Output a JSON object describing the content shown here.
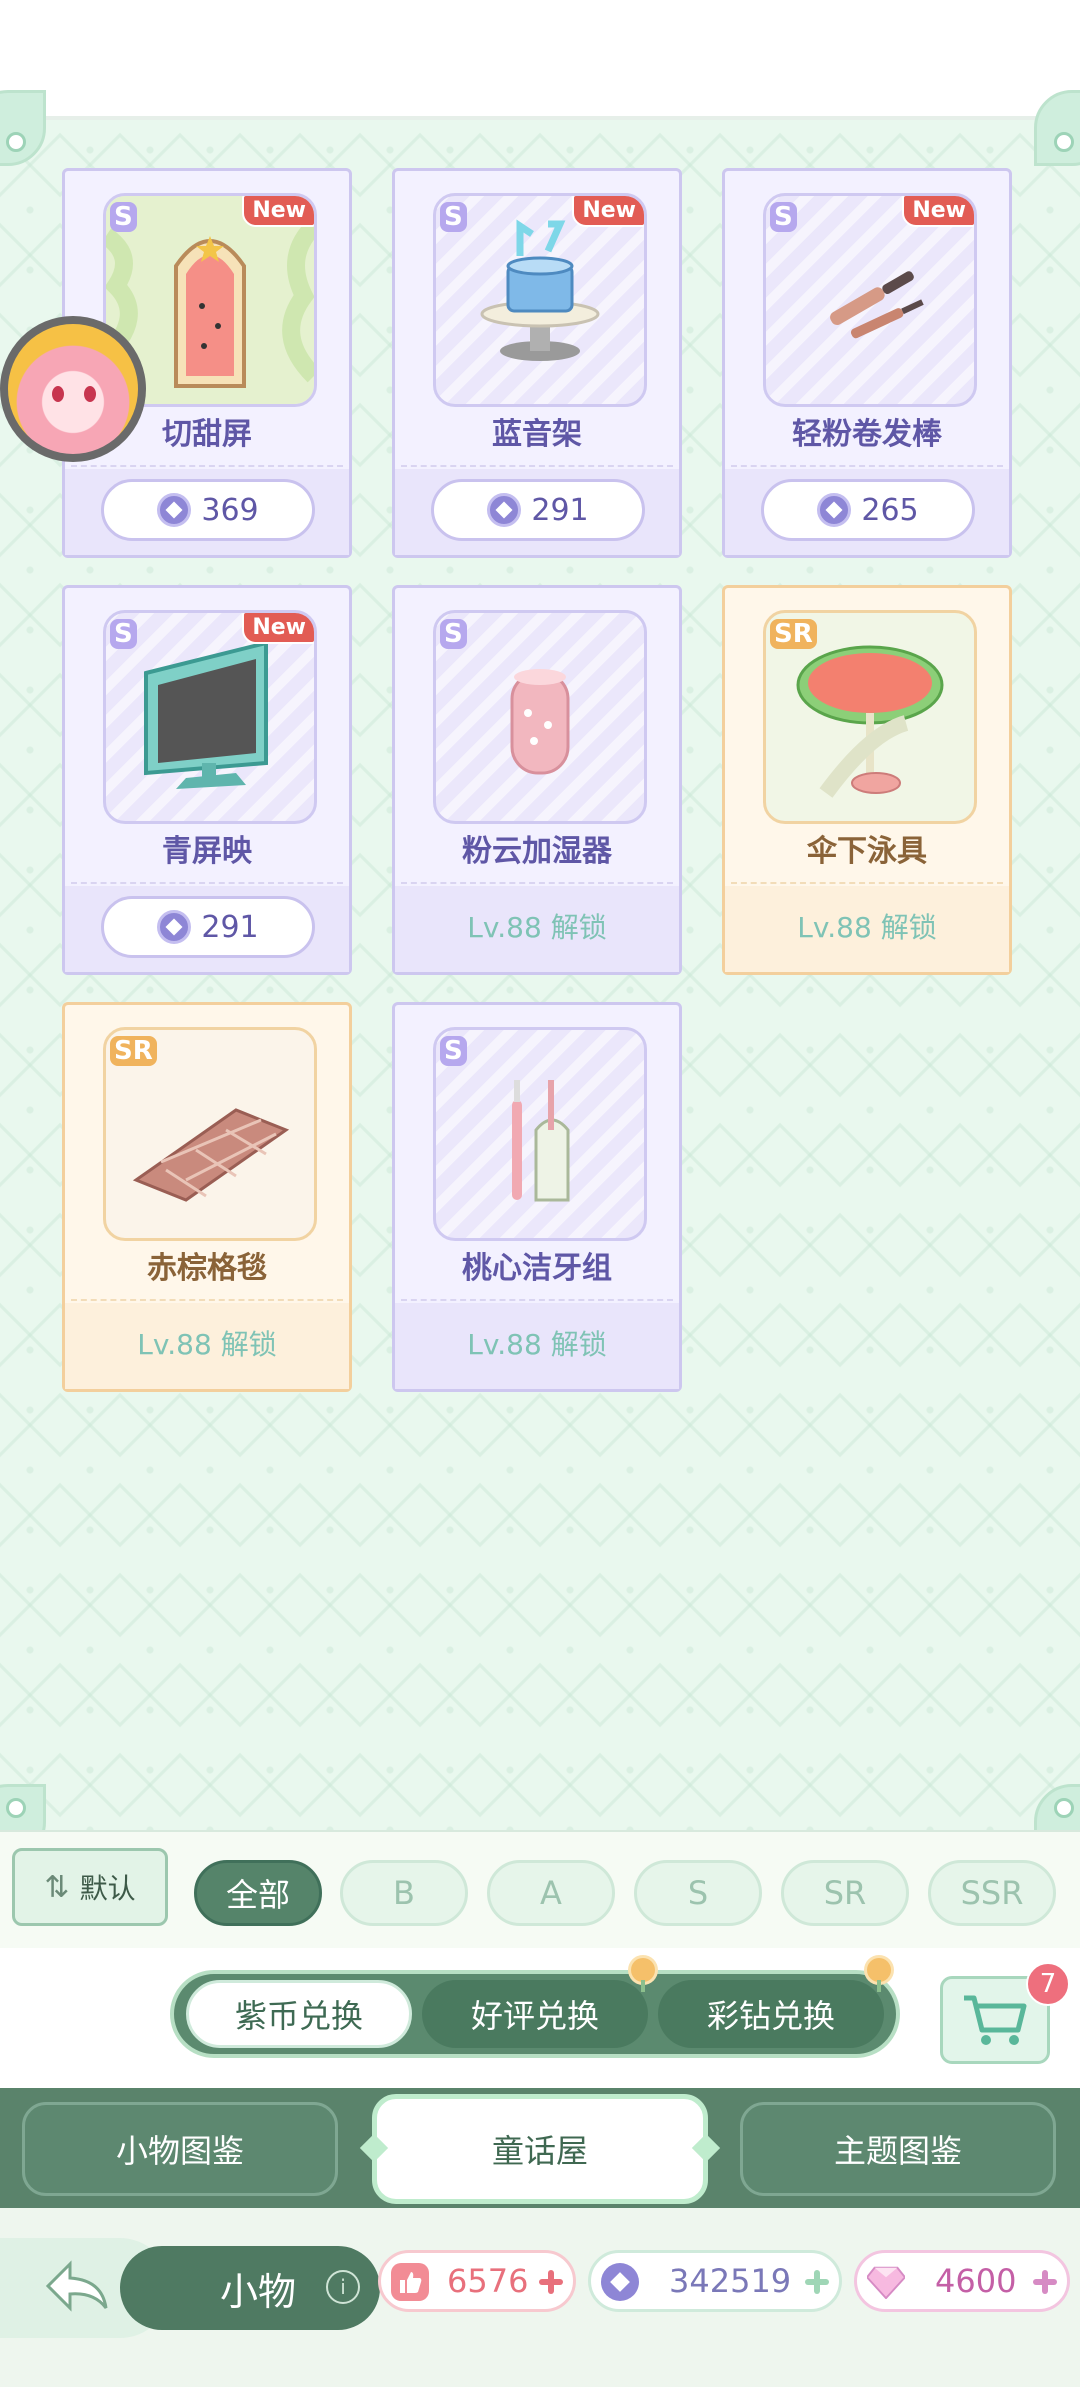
{
  "items": [
    {
      "rarity": "S",
      "is_new": true,
      "new_label": "New",
      "name": "切甜屏",
      "price": "369",
      "unlock": ""
    },
    {
      "rarity": "S",
      "is_new": true,
      "new_label": "New",
      "name": "蓝音架",
      "price": "291",
      "unlock": ""
    },
    {
      "rarity": "S",
      "is_new": true,
      "new_label": "New",
      "name": "轻粉卷发棒",
      "price": "265",
      "unlock": ""
    },
    {
      "rarity": "S",
      "is_new": true,
      "new_label": "New",
      "name": "青屏映",
      "price": "291",
      "unlock": ""
    },
    {
      "rarity": "S",
      "is_new": false,
      "new_label": "",
      "name": "粉云加湿器",
      "price": "",
      "unlock": "Lv.88 解锁"
    },
    {
      "rarity": "SR",
      "is_new": false,
      "new_label": "",
      "name": "伞下泳具",
      "price": "",
      "unlock": "Lv.88 解锁"
    },
    {
      "rarity": "SR",
      "is_new": false,
      "new_label": "",
      "name": "赤棕格毯",
      "price": "",
      "unlock": "Lv.88 解锁"
    },
    {
      "rarity": "S",
      "is_new": false,
      "new_label": "",
      "name": "桃心洁牙组",
      "price": "",
      "unlock": "Lv.88 解锁"
    }
  ],
  "filter": {
    "sort_label": "默认",
    "rarity_tabs": [
      {
        "label": "全部",
        "active": true
      },
      {
        "label": "B",
        "active": false
      },
      {
        "label": "A",
        "active": false
      },
      {
        "label": "S",
        "active": false
      },
      {
        "label": "SR",
        "active": false
      },
      {
        "label": "SSR",
        "active": false
      }
    ]
  },
  "exchange": {
    "tabs": [
      {
        "label": "紫币兑换",
        "active": true
      },
      {
        "label": "好评兑换",
        "active": false
      },
      {
        "label": "彩钻兑换",
        "active": false
      }
    ],
    "cart_count": "7"
  },
  "nav": {
    "tabs": [
      {
        "label": "小物图鉴",
        "active": false
      },
      {
        "label": "童话屋",
        "active": true
      },
      {
        "label": "主题图鉴",
        "active": false
      }
    ]
  },
  "footer": {
    "title": "小物",
    "info_glyph": "i",
    "currencies": [
      {
        "icon": "thumbs-up-icon",
        "value": "6576",
        "color": "#e8707c"
      },
      {
        "icon": "purple-coin-icon",
        "value": "342519",
        "color": "#7a78b8"
      },
      {
        "icon": "diamond-icon",
        "value": "4600",
        "color": "#c45fa6"
      }
    ]
  },
  "colors": {
    "accent_green": "#55846a",
    "card_s_border": "#cdc7ef",
    "card_sr_border": "#f3cf9c"
  }
}
